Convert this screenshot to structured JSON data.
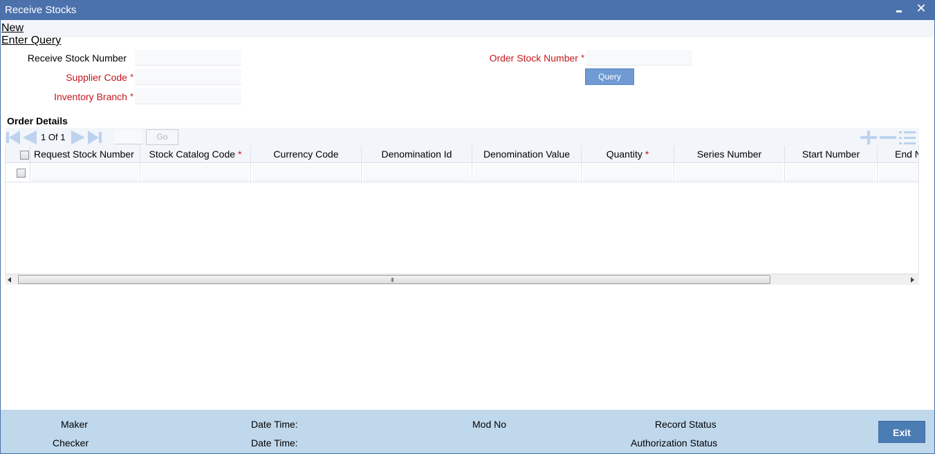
{
  "window": {
    "title": "Receive Stocks"
  },
  "menu": {
    "new": "New",
    "enter_query": "Enter Query"
  },
  "form": {
    "receive_stock_number": {
      "label": "Receive Stock Number",
      "value": ""
    },
    "supplier_code": {
      "label": "Supplier Code",
      "value": ""
    },
    "inventory_branch": {
      "label": "Inventory Branch",
      "value": ""
    },
    "order_stock_number": {
      "label": "Order Stock Number",
      "value": ""
    },
    "required_mark": "*",
    "query_button": "Query"
  },
  "order_details": {
    "title": "Order Details",
    "pagination": {
      "current": "1",
      "of_label": "Of",
      "total": "1",
      "go": "Go"
    },
    "columns": [
      {
        "label": "Request Stock Number",
        "required": false
      },
      {
        "label": "Stock Catalog Code",
        "required": true
      },
      {
        "label": "Currency Code",
        "required": false
      },
      {
        "label": "Denomination Id",
        "required": false
      },
      {
        "label": "Denomination Value",
        "required": false
      },
      {
        "label": "Quantity",
        "required": true
      },
      {
        "label": "Series Number",
        "required": false
      },
      {
        "label": "Start Number",
        "required": false
      },
      {
        "label": "End Number",
        "required": false
      }
    ],
    "required_mark": "*",
    "scroll_grip": "III"
  },
  "footer": {
    "maker": "Maker",
    "checker": "Checker",
    "date_time_1": "Date Time:",
    "date_time_2": "Date Time:",
    "mod_no": "Mod No",
    "record_status": "Record Status",
    "authorization_status": "Authorization Status",
    "exit": "Exit"
  }
}
